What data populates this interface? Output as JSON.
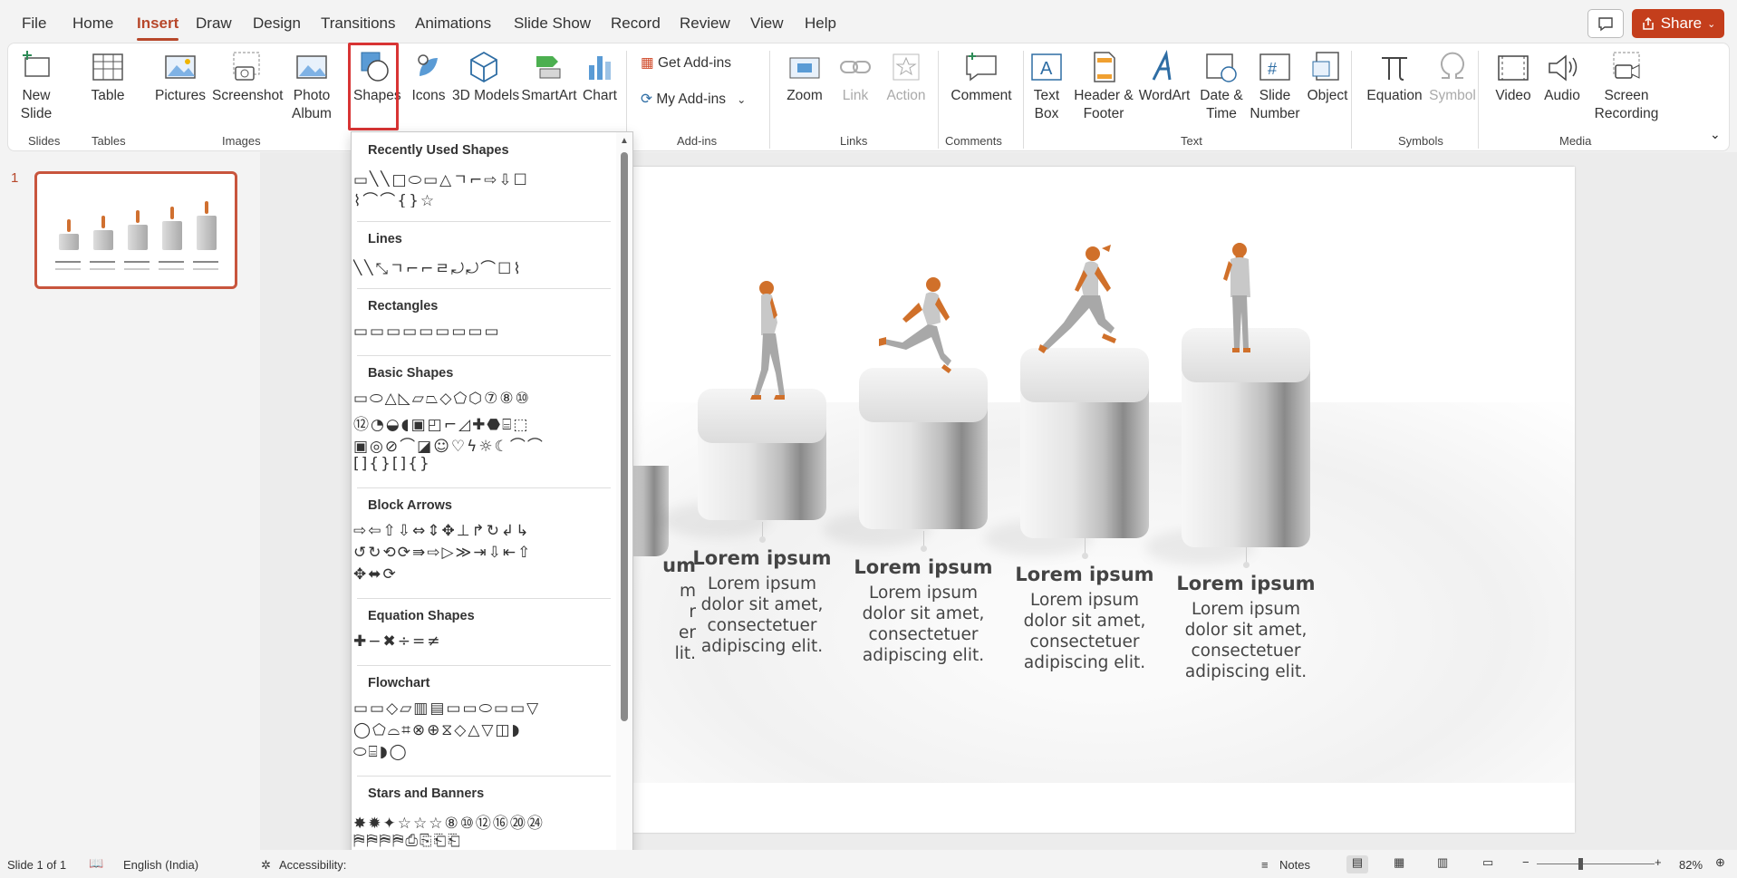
{
  "menu": {
    "items": [
      "File",
      "Home",
      "Insert",
      "Draw",
      "Design",
      "Transitions",
      "Animations",
      "Slide Show",
      "Record",
      "Review",
      "View",
      "Help"
    ],
    "active": "Insert",
    "share_label": "Share"
  },
  "ribbon": {
    "new_slide": "New Slide",
    "table": "Table",
    "pictures": "Pictures",
    "screenshot": "Screenshot",
    "photo_album": "Photo Album",
    "shapes": "Shapes",
    "icons": "Icons",
    "models_3d": "3D Models",
    "smartart": "SmartArt",
    "chart": "Chart",
    "get_addins": "Get Add-ins",
    "my_addins": "My Add-ins",
    "zoom": "Zoom",
    "link": "Link",
    "action": "Action",
    "comment": "Comment",
    "text_box": "Text Box",
    "header_footer": "Header & Footer",
    "wordart": "WordArt",
    "date_time": "Date & Time",
    "slide_number": "Slide Number",
    "object": "Object",
    "equation": "Equation",
    "symbol": "Symbol",
    "video": "Video",
    "audio": "Audio",
    "screen_recording": "Screen Recording",
    "groups": {
      "slides": "Slides",
      "tables": "Tables",
      "images": "Images",
      "addins": "Add-ins",
      "links": "Links",
      "comments": "Comments",
      "text": "Text",
      "symbols": "Symbols",
      "media": "Media"
    }
  },
  "shapes_panel": {
    "sections": [
      {
        "title": "Recently Used Shapes",
        "rows": [
          "▭╲╲□⬭▭△ㄱ⌐⇨⇩☐",
          "⌇⌒⌒{}☆"
        ]
      },
      {
        "title": "Lines",
        "rows": [
          "╲╲⤡ㄱ⌐⌐ㄹ⤾⤾⌒☐⌇"
        ]
      },
      {
        "title": "Rectangles",
        "rows": [
          "▭▭▭▭▭▭▭▭▭"
        ]
      },
      {
        "title": "Basic Shapes",
        "rows": [
          "▭⬭△◺▱⏢◇⬠⬡⑦⑧⑩",
          "⑫◔◒◖▣◰⌐◿✚⬣⌸⬚",
          "▣◎⊘⌒◪☺♡ϟ☼☾⌒⌒",
          "[]{}[]{}"
        ]
      },
      {
        "title": "Block Arrows",
        "rows": [
          "⇨⇦⇧⇩⇔⇕✥⊥↱↻↲↳",
          "↺↻⟲⟳⇛⇨▷≫⇥⇩⇤⇧",
          "✥⬌⟳"
        ]
      },
      {
        "title": "Equation Shapes",
        "rows": [
          "✚−✖÷=≠"
        ]
      },
      {
        "title": "Flowchart",
        "rows": [
          "▭▭◇▱▥▤▭▭⬭▭▭▽",
          "◯⬠⌓⌗⊗⊕⧖◇△▽◫◗",
          "⬭⌸◗◯"
        ]
      },
      {
        "title": "Stars and Banners",
        "rows": [
          "✸✹✦☆☆☆⑧⑩⑫⑯⑳㉔",
          "⛿⛿⛿⛿⎙⎘⎗⎗"
        ]
      }
    ]
  },
  "slide": {
    "number": "1",
    "partial_caption": {
      "heading": "um",
      "body": [
        "m",
        "r",
        "er",
        "lit."
      ]
    },
    "steps": [
      {
        "heading": "Lorem ipsum",
        "body": [
          "Lorem ipsum",
          "dolor sit amet,",
          "consectetuer",
          "adipiscing elit."
        ]
      },
      {
        "heading": "Lorem ipsum",
        "body": [
          "Lorem ipsum",
          "dolor sit amet,",
          "consectetuer",
          "adipiscing elit."
        ]
      },
      {
        "heading": "Lorem ipsum",
        "body": [
          "Lorem ipsum",
          "dolor sit amet,",
          "consectetuer",
          "adipiscing elit."
        ]
      },
      {
        "heading": "Lorem ipsum",
        "body": [
          "Lorem ipsum",
          "dolor sit amet,",
          "consectetuer",
          "adipiscing elit."
        ]
      }
    ],
    "accent_color": "#d0702a"
  },
  "status": {
    "slide_of": "Slide 1 of 1",
    "language": "English (India)",
    "accessibility": "Accessibility:",
    "notes": "Notes",
    "zoom": "82%"
  }
}
